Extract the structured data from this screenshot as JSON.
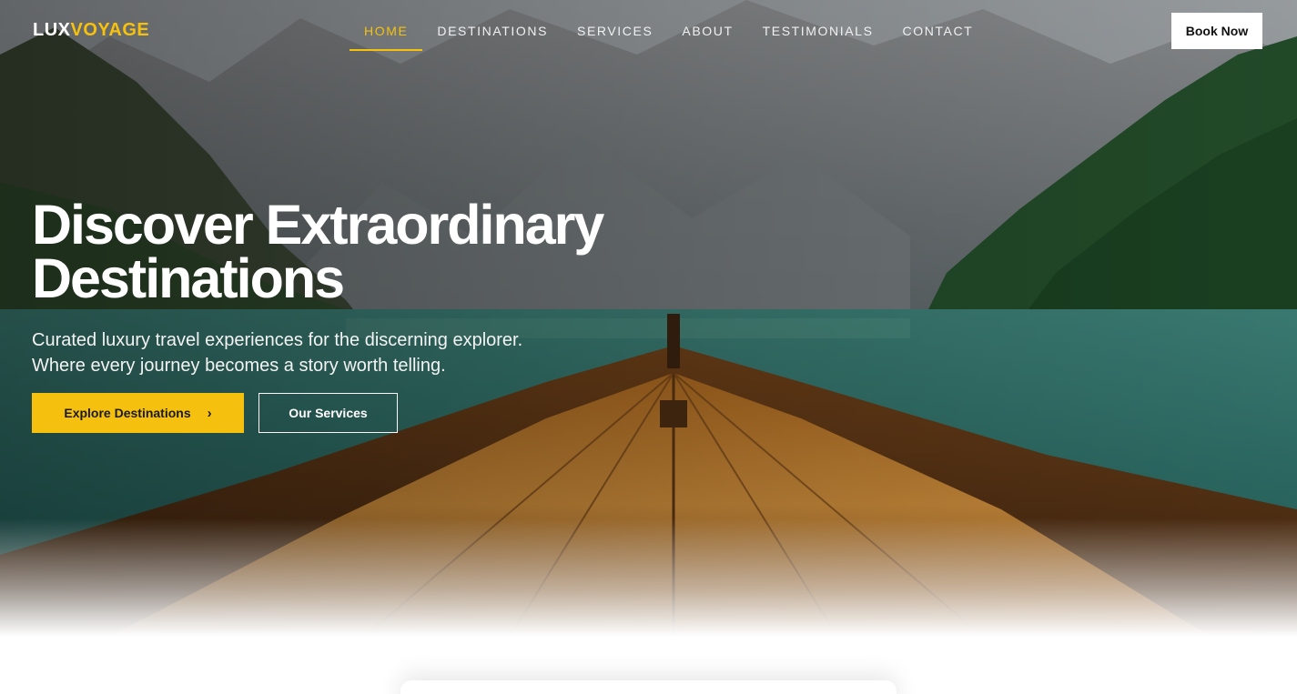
{
  "brand": {
    "part1": "LUX",
    "part2": "VOYAGE"
  },
  "nav": {
    "items": [
      {
        "label": "HOME",
        "active": true
      },
      {
        "label": "DESTINATIONS",
        "active": false
      },
      {
        "label": "SERVICES",
        "active": false
      },
      {
        "label": "ABOUT",
        "active": false
      },
      {
        "label": "TESTIMONIALS",
        "active": false
      },
      {
        "label": "CONTACT",
        "active": false
      }
    ],
    "book_label": "Book Now"
  },
  "hero": {
    "headline_line1": "Discover Extraordinary",
    "headline_line2": "Destinations",
    "sub_line1": "Curated luxury travel experiences for the discerning explorer.",
    "sub_line2": "Where every journey becomes a story worth telling.",
    "primary_cta": "Explore Destinations",
    "primary_cta_icon": "chevron-right-icon",
    "secondary_cta": "Our Services",
    "background": "boat-on-mountain-lake-photo"
  },
  "colors": {
    "accent": "#f6c10e",
    "text_light": "#ffffff",
    "button_dark_text": "#1a1a1a"
  }
}
